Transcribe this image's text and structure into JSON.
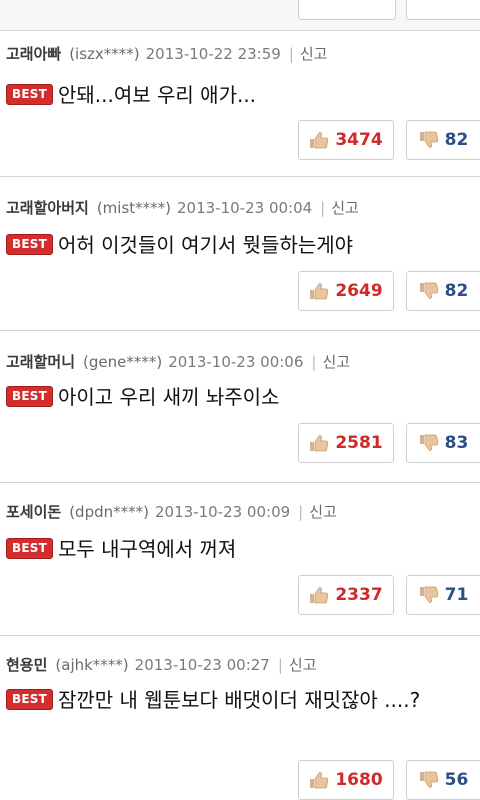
{
  "colors": {
    "best": "#d22e2e",
    "like": "#cf2a2a",
    "dislike": "#2b4f86"
  },
  "report_label": "신고",
  "badge_label": "BEST",
  "comments": [
    {
      "nick": "고래아빠",
      "uid": "(iszx****)",
      "date": "2013-10-22 23:59",
      "text": "안돼...여보 우리 애가...",
      "likes": "3474",
      "dislikes": "82"
    },
    {
      "nick": "고래할아버지",
      "uid": "(mist****)",
      "date": "2013-10-23 00:04",
      "text": "어허 이것들이 여기서 뭣들하는게야",
      "likes": "2649",
      "dislikes": "82"
    },
    {
      "nick": "고래할머니",
      "uid": "(gene****)",
      "date": "2013-10-23 00:06",
      "text": "아이고 우리 새끼 놔주이소",
      "likes": "2581",
      "dislikes": "83"
    },
    {
      "nick": "포세이돈",
      "uid": "(dpdn****)",
      "date": "2013-10-23 00:09",
      "text": "모두 내구역에서 꺼져",
      "likes": "2337",
      "dislikes": "71"
    },
    {
      "nick": "현용민",
      "uid": "(ajhk****)",
      "date": "2013-10-23 00:27",
      "text": "잠깐만 내 웹툰보다 배댓이더 재밋잖아 ....?",
      "likes": "1680",
      "dislikes": "56"
    }
  ]
}
